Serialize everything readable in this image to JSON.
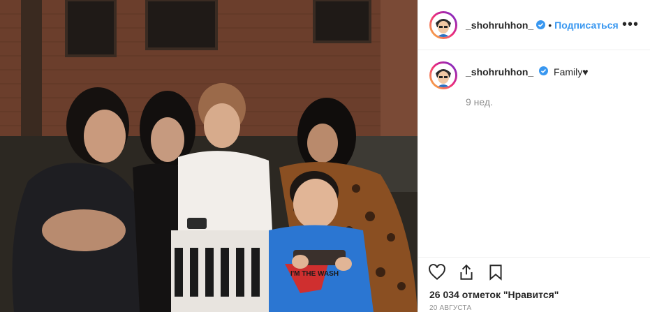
{
  "colors": {
    "accent": "#3897f0",
    "verified": "#3897f0",
    "text": "#262626",
    "muted": "#8e8e8e",
    "border": "#efefef"
  },
  "photo": {
    "shirt_text": "I'M THE WASH"
  },
  "header": {
    "username": "_shohruhhon_",
    "separator": "•",
    "follow_label": "Подписаться",
    "more_label": "•••"
  },
  "caption": {
    "username": "_shohruhhon_",
    "text": "Family♥",
    "time_ago": "9 нед."
  },
  "actions": {
    "icons": [
      "heart-icon",
      "share-icon",
      "bookmark-icon"
    ]
  },
  "likes": {
    "text": "26 034 отметок \"Нравится\""
  },
  "date": {
    "text": "20 АВГУСТА"
  }
}
